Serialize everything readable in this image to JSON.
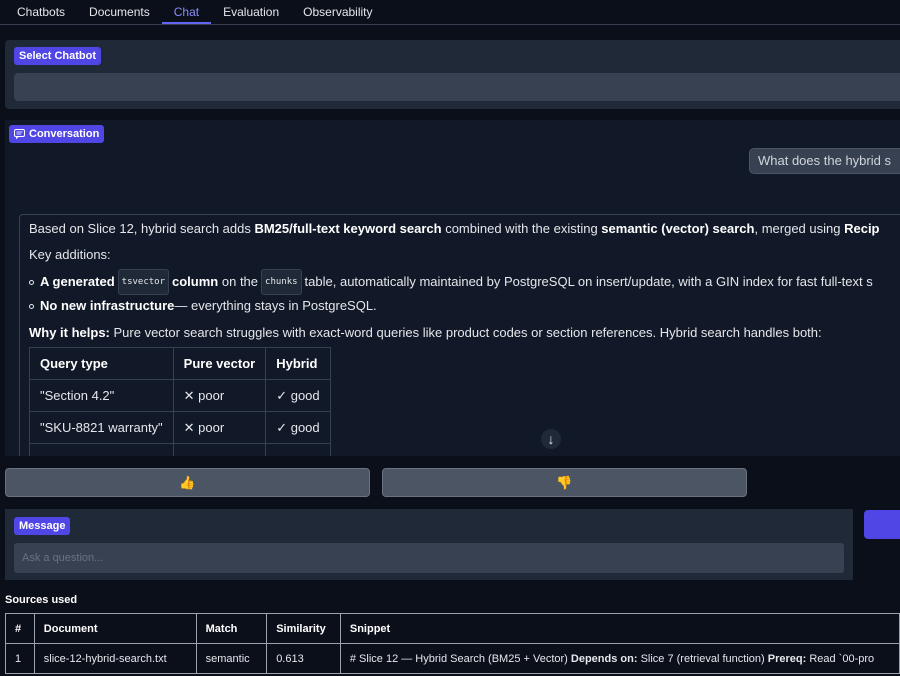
{
  "tabs": [
    "Chatbots",
    "Documents",
    "Chat",
    "Evaluation",
    "Observability"
  ],
  "select_chatbot": {
    "label": "Select Chatbot",
    "value": ""
  },
  "conversation": {
    "label": "Conversation",
    "user_message": "What does the hybrid s",
    "bot": {
      "intro_pre": "Based on Slice 12, hybrid search adds ",
      "intro_b1": "BM25/full-text keyword search",
      "intro_mid": " combined with the existing ",
      "intro_b2": "semantic (vector) search",
      "intro_post": ", merged using ",
      "intro_b3": "Recip",
      "key_additions": "Key additions:",
      "bullet1_b": "A generated",
      "bullet1_code1": "tsvector",
      "bullet1_b2": "column",
      "bullet1_mid": "on the",
      "bullet1_code2": "chunks",
      "bullet1_post": "table, automatically maintained by PostgreSQL on insert/update, with a GIN index for fast full-text s",
      "bullet2_b": "No new infrastructure",
      "bullet2_post": " — everything stays in PostgreSQL.",
      "why_b": "Why it helps:",
      "why_post": " Pure vector search struggles with exact-word queries like product codes or section references. Hybrid search handles both:",
      "table": {
        "headers": [
          "Query type",
          "Pure vector",
          "Hybrid"
        ],
        "rows": [
          [
            "\"Section 4.2\"",
            "✕ poor",
            "✓ good"
          ],
          [
            "\"SKU-8821 warranty\"",
            "✕ poor",
            "✓ good"
          ]
        ]
      }
    },
    "scroll_icon": "arrow-down-icon"
  },
  "feedback": {
    "up": "👍",
    "down": "👎"
  },
  "message": {
    "label": "Message",
    "placeholder": "Ask a question..."
  },
  "sources": {
    "title": "Sources used",
    "headers": [
      "#",
      "Document",
      "Match",
      "Similarity",
      "Snippet"
    ],
    "rows": [
      {
        "num": "1",
        "document": "slice-12-hybrid-search.txt",
        "match": "semantic",
        "similarity": "0.613",
        "snippet_a": "# Slice 12 — Hybrid Search (BM25 + Vector) ",
        "snippet_b1": "Depends on:",
        "snippet_c": " Slice 7 (retrieval function) ",
        "snippet_b2": "Prereq:",
        "snippet_d": " Read `00-pro"
      }
    ]
  },
  "colors": {
    "accent": "#4f46e5",
    "background": "#0b0f19",
    "panel": "#1f2937"
  }
}
